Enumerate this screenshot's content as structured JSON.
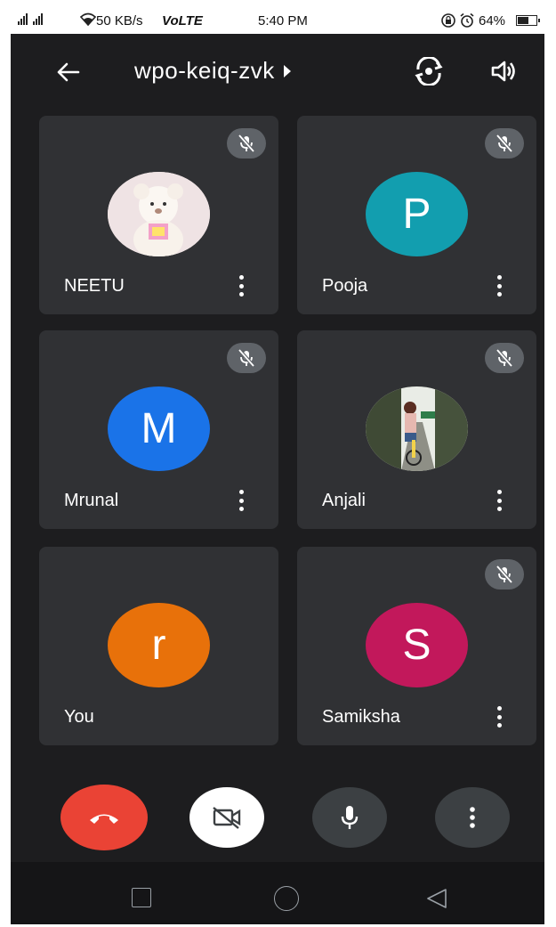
{
  "status_bar": {
    "signal_icon": "signal-bars-icon",
    "network_speed": "50 KB/s",
    "network_type": "VoLTE",
    "time": "5:40 PM",
    "battery_percent": "64%",
    "battery_level": 0.64
  },
  "header": {
    "meeting_code": "wpo-keiq-zvk"
  },
  "participants": [
    {
      "name": "NEETU",
      "avatar_type": "photo",
      "avatar_color": "#f1e6e6",
      "muted": true,
      "has_menu": true
    },
    {
      "name": "Pooja",
      "initial": "P",
      "avatar_type": "initial",
      "avatar_color": "#129eaf",
      "muted": true,
      "has_menu": true
    },
    {
      "name": "Mrunal",
      "initial": "M",
      "avatar_type": "initial",
      "avatar_color": "#1a73e8",
      "muted": true,
      "has_menu": true
    },
    {
      "name": "Anjali",
      "avatar_type": "photo",
      "avatar_color": "#5a6b4f",
      "muted": true,
      "has_menu": true
    },
    {
      "name": "You",
      "initial": "r",
      "avatar_type": "initial",
      "avatar_color": "#e8710a",
      "muted": false,
      "has_menu": false
    },
    {
      "name": "Samiksha",
      "initial": "S",
      "avatar_type": "initial",
      "avatar_color": "#c2185b",
      "muted": true,
      "has_menu": true
    }
  ],
  "colors": {
    "background": "#1d1d1f",
    "tile": "#303134",
    "end_call": "#ea4335",
    "control_dark": "#3c4043",
    "mute_badge": "#5f6368"
  }
}
